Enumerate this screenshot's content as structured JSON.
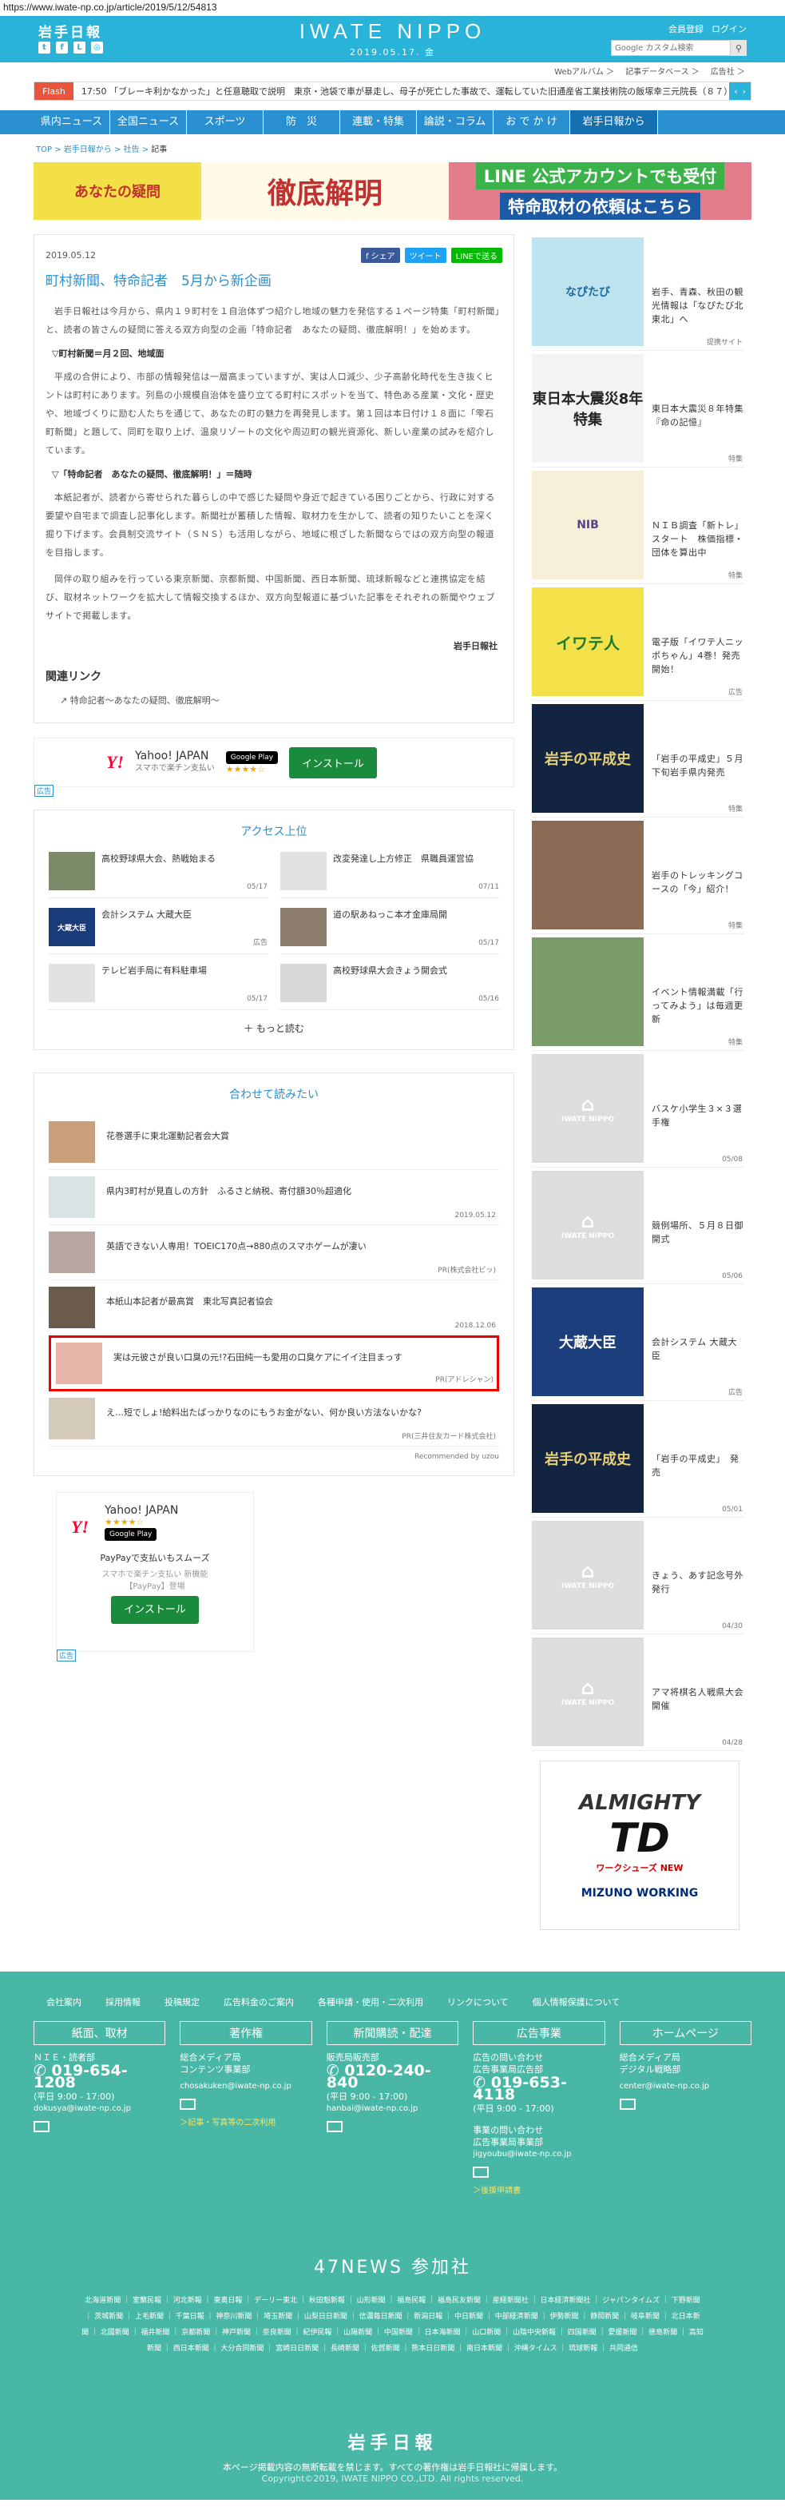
{
  "url": "https://www.iwate-np.co.jp/article/2019/5/12/54813",
  "header": {
    "logo_ja": "岩手日報",
    "brand": "IWATE NIPPO",
    "date": "2019.05.17. 金",
    "member": "会員登録",
    "login": "ログイン",
    "search_placeholder": "Google カスタム検索",
    "sns_icons": [
      "twitter-icon",
      "facebook-icon",
      "line-icon",
      "instagram-icon"
    ]
  },
  "subnav": [
    "Webアルバム ＞",
    "記事データベース ＞",
    "広告社 ＞"
  ],
  "flash": {
    "tag": "Flash",
    "text": "17:50 「ブレーキ利かなかった」と任意聴取で説明　東京・池袋で車が暴走し、母子が死亡した事故で、運転していた旧通産省工業技術院の飯塚幸三元院長（８７）"
  },
  "gnav": [
    "県内ニュース",
    "全国ニュース",
    "スポーツ",
    "防　災",
    "連載・特集",
    "論説・コラム",
    "お で か け",
    "岩手日報から"
  ],
  "crumb": [
    "TOP",
    "岩手日報から",
    "社告",
    "記事"
  ],
  "banner": {
    "left": "あなたの疑問",
    "mid": "徹底解明",
    "line1": "LINE 公式アカウントでも受付",
    "line2": "特命取材の依頼はこちら"
  },
  "article": {
    "date": "2019.05.12",
    "share_fb": "f シェア",
    "share_tw": "ツイート",
    "share_line": "LINEで送る",
    "title": "町村新聞、特命記者　5月から新企画",
    "p1": "岩手日報社は今月から、県内１９町村を１自治体ずつ紹介し地域の魅力を発信する１ページ特集「町村新聞」と、読者の皆さんの疑問に答える双方向型の企画「特命記者　あなたの疑問、徹底解明！」を始めます。",
    "h1": "▽町村新聞＝月２回、地域面",
    "p2": "平成の合併により、市部の情報発信は一層高まっていますが、実は人口減少、少子高齢化時代を生き抜くヒントは町村にあります。列島の小規模自治体を盛り立てる町村にスポットを当て、特色ある産業・文化・歴史や、地域づくりに励む人たちを通じて、あなたの町の魅力を再発見します。第１回は本日付け１８面に「雫石町新聞」と題して、同町を取り上げ、温泉リゾートの文化や周辺町の観光資源化、新しい産業の試みを紹介しています。",
    "h2": "▽「特命記者　あなたの疑問、徹底解明！」＝随時",
    "p3": "本紙記者が、読者から寄せられた暮らしの中で感じた疑問や身近で起きている困りごとから、行政に対する要望や自宅まで調査し記事化します。新聞社が蓄積した情報、取材力を生かして、読者の知りたいことを深く掘り下げます。会員制交流サイト（ＳＮＳ）も活用しながら、地域に根ざした新聞ならではの双方向型の報道を目指します。",
    "p4": "岡伴の取り組みを行っている東京新聞、京都新聞、中国新聞、西日本新聞、琉球新報などと連携協定を結び、取材ネットワークを拡大して情報交換するほか、双方向型報道に基づいた記事をそれぞれの新聞やウェブサイトで掲載します。",
    "sign": "岩手日報社",
    "related_h": "関連リンク",
    "related_link": "特命記者～あなたの疑問、徹底解明～"
  },
  "ad_yahoo": {
    "brand": "Yahoo! JAPAN",
    "sub": "スマホで楽チン支払い",
    "gplay": "Google Play",
    "stars": "★★★★☆",
    "install": "インストール",
    "tag": "広告"
  },
  "access": {
    "heading": "アクセス上位",
    "items": [
      {
        "title": "高校野球県大会、熱戦始まる",
        "date": "05/17"
      },
      {
        "title": "改変発達し上方修正　県職員運営協",
        "date": "07/11"
      },
      {
        "title": "会計システム 大蔵大臣",
        "date": "広告"
      },
      {
        "title": "道の駅あねっこ本才金庫局開",
        "date": "05/17"
      },
      {
        "title": "テレビ岩手局に有料駐車場",
        "date": "05/17"
      },
      {
        "title": "高校野球県大会きょう開会式",
        "date": "05/16"
      }
    ],
    "more": "もっと読む"
  },
  "recommend": {
    "heading": "合わせて読みたい",
    "items": [
      {
        "title": "花巻選手に東北運動記者会大賞",
        "date": ""
      },
      {
        "title": "県内3町村が見直しの方針　ふるさと納税、寄付額30％超適化",
        "date": "2019.05.12"
      },
      {
        "title": "英語できない人専用！TOEIC170点→880点のスマホゲームが凄い",
        "date": "PR(株式会社ビッ)"
      },
      {
        "title": "本紙山本記者が最高賞　東北写真記者協会",
        "date": "2018.12.06"
      },
      {
        "title": "実は元彼さが良い口臭の元!?石田純一も愛用の口臭ケアにイイ注目まっす",
        "date": "PR(アドレシャン)"
      },
      {
        "title": "え…短でしょ!給料出たばっかりなのにもうお金がない、何か良い方法ないかな?",
        "date": "PR(三井住友カード株式会社)"
      }
    ],
    "powered": "Recommended by uzou"
  },
  "ad_box": {
    "brand": "Yahoo! JAPAN",
    "stars": "★★★★☆",
    "gplay": "Google Play",
    "line1": "PayPayで支払いもスムーズ",
    "line2": "スマホで楽チン支払い 新機能",
    "line3": "【PayPay】登場",
    "install": "インストール",
    "tag": "広告"
  },
  "side": [
    {
      "title": "岩手、青森、秋田の観光情報は「なぴたび北東北」へ",
      "tag": "提携サイト",
      "img": "なぴたび"
    },
    {
      "title": "東日本大震災８年特集　『命の記憶』",
      "tag": "特集",
      "img": "東日本大震災8年特集"
    },
    {
      "title": "ＮＩＢ調査「新トレ」スタート　株価指標・団体を算出中",
      "tag": "特集",
      "img": "NIB"
    },
    {
      "title": "電子版「イワテ人ニッポちゃん」4巻！発売開始！",
      "tag": "広告",
      "img": "イワテ人"
    },
    {
      "title": "「岩手の平成史」５月下旬岩手県内発売",
      "tag": "特集",
      "img": "岩手の平成史"
    },
    {
      "title": "岩手のトレッキングコースの「今」紹介！",
      "tag": "特集",
      "img": ""
    },
    {
      "title": "イベント情報満載「行ってみよう」は毎週更新",
      "tag": "特集",
      "img": ""
    },
    {
      "title": "バスケ小学生３×３選手権",
      "tag": "05/08",
      "img": "IWATE NIPPO"
    },
    {
      "title": "競例場所、５月８日御開式",
      "tag": "05/06",
      "img": "IWATE NIPPO"
    },
    {
      "title": "会計システム 大蔵大臣",
      "tag": "広告",
      "img": "大蔵大臣"
    },
    {
      "title": "「岩手の平成史」　発売",
      "tag": "05/01",
      "img": "岩手の平成史"
    },
    {
      "title": "きょう、あす記念号外発行",
      "tag": "04/30",
      "img": "IWATE NIPPO"
    },
    {
      "title": "アマ将棋名人戦県大会開催",
      "tag": "04/28",
      "img": "IWATE NIPPO"
    }
  ],
  "side_ad": {
    "title": "ALMIGHTY",
    "sub": "TD",
    "tag": "ワークシューズ NEW",
    "brand": "MIZUNO WORKING"
  },
  "footer": {
    "links": [
      "会社案内",
      "採用情報",
      "投稿規定",
      "広告料金のご案内",
      "各種申請・使用・二次利用",
      "リンクについて",
      "個人情報保護について"
    ],
    "cols": [
      {
        "h": "紙面、取材",
        "l1": "ＮＩＥ・読者部",
        "tel": "019-654-1208",
        "hours": "(平日 9:00 - 17:00)",
        "mail": "dokusya@iwate-np.co.jp",
        "sub": ""
      },
      {
        "h": "著作権",
        "l1": "総合メディア局",
        "l2": "コンテンツ事業部",
        "mail": "chosakuken@iwate-np.co.jp",
        "sub": "＞記事・写真等の二次利用"
      },
      {
        "h": "新聞購読・配達",
        "l1": "販売局販売部",
        "tel": "0120-240-840",
        "hours": "(平日 9:00 - 17:00)",
        "mail": "hanbai@iwate-np.co.jp",
        "sub": ""
      },
      {
        "h": "広告事業",
        "l1": "広告の問い合わせ",
        "l2": "広告事業局広告部",
        "tel": "019-653-4118",
        "hours": "(平日 9:00 - 17:00)",
        "l3": "事業の問い合わせ",
        "l4": "広告事業局事業部",
        "mail": "jigyoubu@iwate-np.co.jp",
        "sub": "＞後援申請書"
      },
      {
        "h": "ホームページ",
        "l1": "総合メディア局",
        "l2": "デジタル戦略部",
        "mail": "center@iwate-np.co.jp",
        "sub": ""
      }
    ],
    "n47_title": "47NEWS 参加社",
    "n47_list": "北海道新聞 ｜ 室蘭民報 ｜ 河北新報 ｜ 東奥日報 ｜ デーリー東北 ｜ 秋田魁新報 ｜ 山形新聞 ｜ 福島民報 ｜ 福島民友新聞 ｜ 産経新聞社 ｜ 日本経済新聞社 ｜ ジャパンタイムズ ｜ 下野新聞 ｜ 茨城新聞 ｜ 上毛新聞 ｜ 千葉日報 ｜ 神奈川新聞 ｜ 埼玉新聞 ｜ 山梨日日新聞 ｜ 信濃毎日新聞 ｜ 新潟日報 ｜ 中日新聞 ｜ 中部経済新聞 ｜ 伊勢新聞 ｜ 静岡新聞 ｜ 岐阜新聞 ｜ 北日本新聞 ｜ 北國新聞 ｜ 福井新聞 ｜ 京都新聞 ｜ 神戸新聞 ｜ 奈良新聞 ｜ 紀伊民報 ｜ 山陽新聞 ｜ 中国新聞 ｜ 日本海新聞 ｜ 山口新聞 ｜ 山陰中央新報 ｜ 四国新聞 ｜ 愛媛新聞 ｜ 徳島新聞 ｜ 高知新聞 ｜ 西日本新聞 ｜ 大分合同新聞 ｜ 宮崎日日新聞 ｜ 長崎新聞 ｜ 佐賀新聞 ｜ 熊本日日新聞 ｜ 南日本新聞 ｜ 沖縄タイムス ｜ 琉球新報 ｜ 共同通信",
    "logo": "岩手日報",
    "notice": "本ページ掲載内容の無断転載を禁じます。すべての著作権は岩手日報社に帰属します。",
    "copyright": "Copyright©2019, IWATE NIPPO CO.,LTD. All rights reserved."
  },
  "colors": {
    "header": "#2ab3d8",
    "nav": "#2a8fd0",
    "footer": "#49b7a6",
    "highlight": "#e00000"
  }
}
